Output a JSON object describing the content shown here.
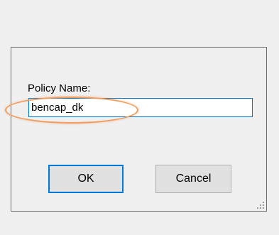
{
  "dialog": {
    "field_label": "Policy Name:",
    "field_value": "bencap_dk",
    "ok_label": "OK",
    "cancel_label": "Cancel"
  },
  "colors": {
    "focus_border": "#0078d7",
    "highlight": "#f29a5a",
    "button_face": "#e1e1e1"
  },
  "icons": {
    "resize_grip": "resize-grip-icon"
  }
}
